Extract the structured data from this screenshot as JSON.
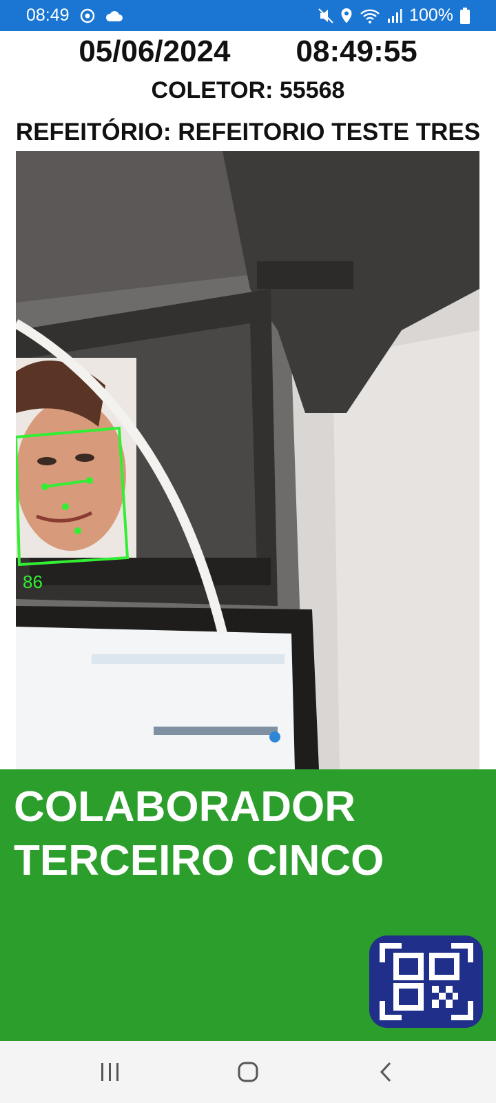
{
  "status_bar": {
    "time": "08:49",
    "battery_text": "100%",
    "icons": [
      "sync-icon",
      "cloud-icon",
      "mute-icon",
      "location-icon",
      "wifi-icon",
      "signal-icon",
      "battery-icon"
    ]
  },
  "header": {
    "date": "05/06/2024",
    "clock": "08:49:55",
    "collector": "COLETOR: 55568",
    "refeitorio": "REFEITÓRIO: REFEITORIO TESTE TRES"
  },
  "camera": {
    "face_score": "86",
    "box_color": "#33ff33"
  },
  "result": {
    "name_line1": "COLABORADOR",
    "name_line2": "TERCEIRO CINCO",
    "panel_color": "#2c9e2c"
  },
  "qr_button": {
    "icon": "qr-code-scan-icon",
    "color": "#1f2f8a"
  },
  "nav": {
    "icons": [
      "recent-apps-icon",
      "home-icon",
      "back-icon"
    ]
  }
}
